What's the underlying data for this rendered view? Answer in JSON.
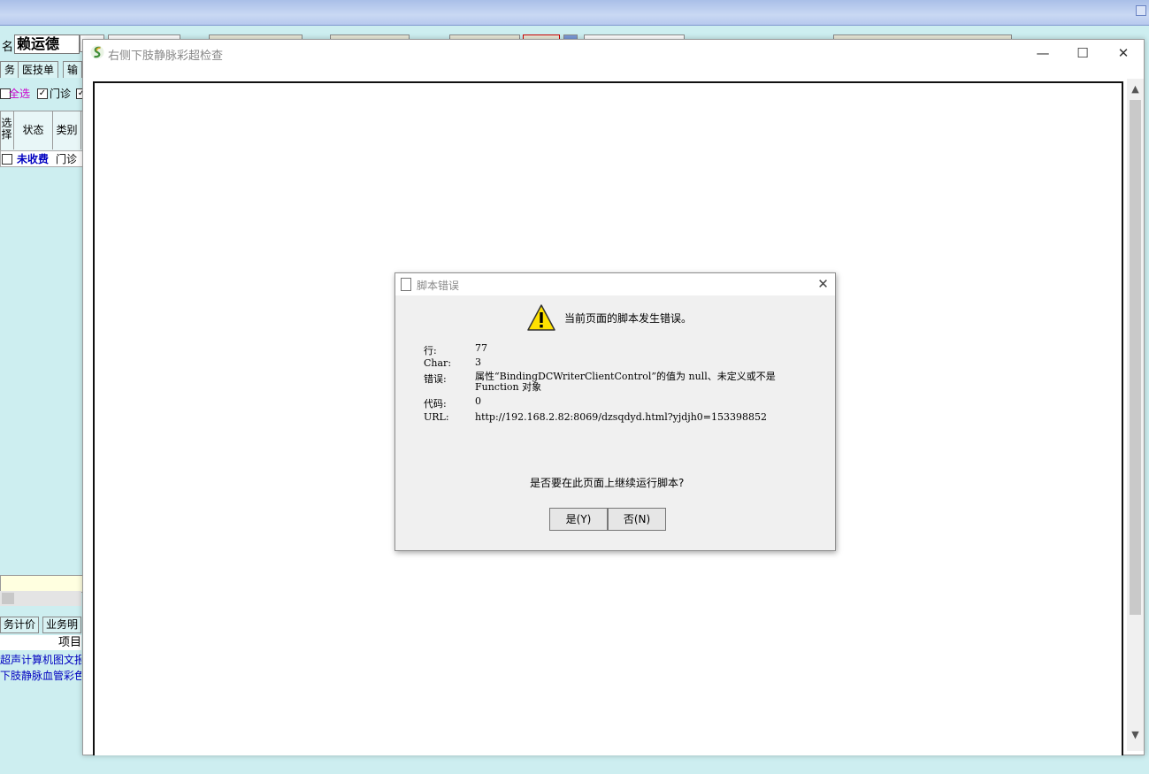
{
  "background_app": {
    "patient": {
      "name_label": "名",
      "name": "赖运德"
    },
    "tabs": [
      "务",
      "医技单",
      "输"
    ],
    "filters": {
      "select_all": "全选",
      "outpatient": "门诊"
    },
    "grid": {
      "headers": [
        "选择",
        "状态",
        "类别"
      ],
      "rows": [
        {
          "status": "未收费",
          "category": "门诊"
        }
      ]
    },
    "bottom_tabs": [
      "务计价",
      "业务明"
    ],
    "list_header": "项目",
    "list_items": [
      "超声计算机图文报",
      "下肢静脉血管彩色"
    ]
  },
  "popup": {
    "title": "右侧下肢静脉彩超检查",
    "buttons": {
      "minimize": "—",
      "maximize": "☐",
      "close": "✕"
    }
  },
  "error_dialog": {
    "title": "脚本错误",
    "message": "当前页面的脚本发生错误。",
    "fields": {
      "line_label": "行:",
      "line_value": "77",
      "char_label": "Char:",
      "char_value": "3",
      "error_label": "错误:",
      "error_value": "属性“BindingDCWriterClientControl”的值为 null、未定义或不是 Function 对象",
      "code_label": "代码:",
      "code_value": "0",
      "url_label": "URL:",
      "url_value": "http://192.168.2.82:8069/dzsqdyd.html?yjdjh0=153398852"
    },
    "question": "是否要在此页面上继续运行脚本?",
    "yes_label": "是(Y)",
    "no_label": "否(N)",
    "close_glyph": "✕"
  },
  "colors": {
    "accent_red": "#cc0000",
    "link_blue": "#0000c0",
    "select_all_magenta": "#cc00cc"
  }
}
